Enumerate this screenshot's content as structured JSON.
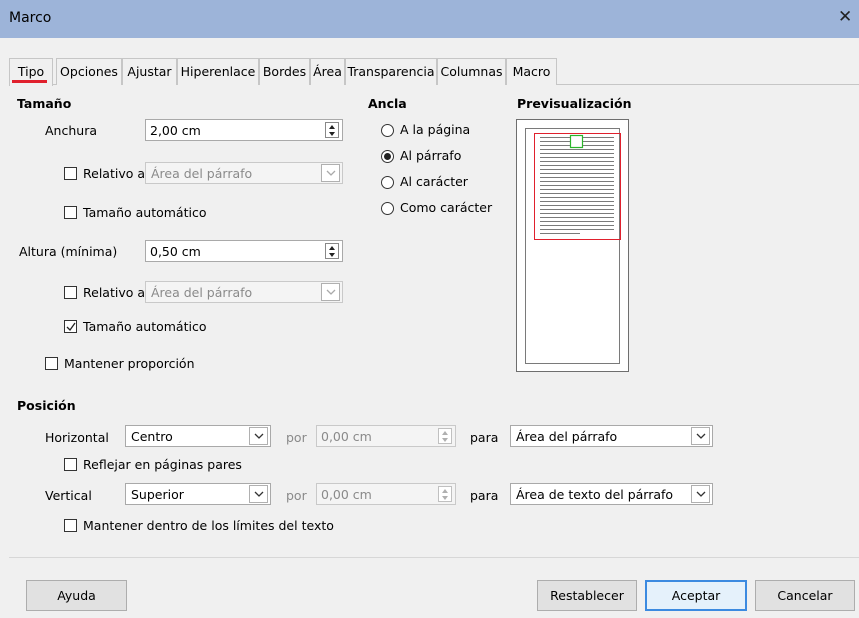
{
  "window": {
    "title": "Marco",
    "close_glyph": "✕"
  },
  "tabs": [
    "Tipo",
    "Opciones",
    "Ajustar",
    "Hiperenlace",
    "Bordes",
    "Área",
    "Transparencia",
    "Columnas",
    "Macro"
  ],
  "active_tab": "Tipo",
  "size": {
    "heading": "Tamaño",
    "width_label": "Anchura",
    "width_value": "2,00 cm",
    "width_relative_label": "Relativo a",
    "width_relative_checked": false,
    "width_relative_value": "Área del párrafo",
    "auto_width_label": "Tamaño automático",
    "auto_width_checked": false,
    "height_label": "Altura (mínima)",
    "height_value": "0,50 cm",
    "height_relative_label": "Relativo a",
    "height_relative_checked": false,
    "height_relative_value": "Área del párrafo",
    "auto_height_label": "Tamaño automático",
    "auto_height_checked": true,
    "keep_ratio_label": "Mantener proporción",
    "keep_ratio_checked": false
  },
  "anchor": {
    "heading": "Ancla",
    "options": [
      "A la página",
      "Al párrafo",
      "Al carácter",
      "Como carácter"
    ],
    "selected": "Al párrafo"
  },
  "preview": {
    "heading": "Previsualización"
  },
  "position": {
    "heading": "Posición",
    "horizontal_label": "Horizontal",
    "horizontal_value": "Centro",
    "by_label": "por",
    "horizontal_by_value": "0,00 cm",
    "to_label": "para",
    "horizontal_to_value": "Área del párrafo",
    "mirror_label": "Reflejar en páginas pares",
    "mirror_checked": false,
    "vertical_label": "Vertical",
    "vertical_value": "Superior",
    "vertical_by_value": "0,00 cm",
    "vertical_to_value": "Área de texto del párrafo",
    "keep_inside_label": "Mantener dentro de los límites del texto",
    "keep_inside_checked": false
  },
  "buttons": {
    "help": "Ayuda",
    "reset": "Restablecer",
    "ok": "Aceptar",
    "cancel": "Cancelar"
  },
  "colors": {
    "titlebar": "#9db4d9",
    "tab_indicator": "#e0202d",
    "preview_frame": "#e0202d",
    "preview_anchor": "#2bb52b",
    "default_button_border": "#3c8ae0"
  }
}
